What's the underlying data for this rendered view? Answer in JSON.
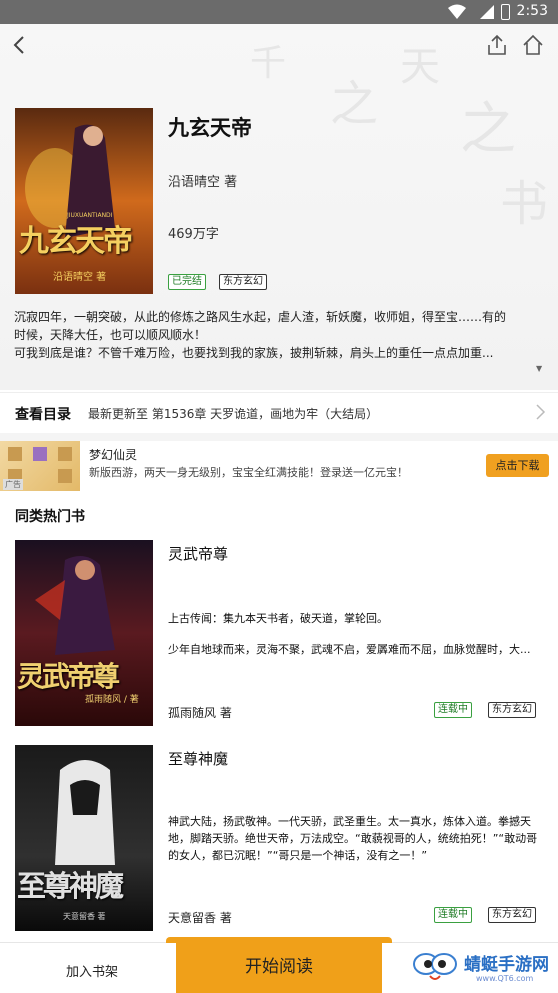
{
  "status_bar": {
    "time": "2:53"
  },
  "book": {
    "title": "九玄天帝",
    "author": "沿语晴空 著",
    "word_count": "469万字",
    "tags": [
      "已完结",
      "东方玄幻"
    ],
    "cover_text": "九玄天帝",
    "cover_author": "沿语晴空 著",
    "cover_pinyin": "JIUXUANTIANDI",
    "description_lines": [
      "沉寂四年，一朝突破，从此的修炼之路风生水起，虐人渣，斩妖魔，收师姐，得至宝……有的",
      "时候，天降大任，也可以顺风顺水！",
      "可我到底是谁？不管千难万险，也要找到我的家族，披荆斩棘，肩头上的重任一点点加重..."
    ]
  },
  "catalog": {
    "label": "查看目录",
    "latest": "最新更新至 第1536章 天罗诡道，画地为牢（大结局）"
  },
  "ad": {
    "title": "梦幻仙灵",
    "subtitle": "新版西游，两天一身无级别，宝宝全红满技能！登录送一亿元宝！",
    "button": "点击下载",
    "badge": "广告"
  },
  "similar": {
    "title": "同类热门书",
    "items": [
      {
        "title": "灵武帝尊",
        "desc1": "上古传闻：集九本天书者，破天道，掌轮回。",
        "desc2": "少年自地球而来，灵海不聚，武魂不启，爱羼难而不屈，血脉觉醒时，大...",
        "author": "孤雨随风",
        "author_suffix": "著",
        "tags": [
          "连载中",
          "东方玄幻"
        ],
        "cover_text": "灵武帝尊",
        "cover_author": "孤雨随风 / 著"
      },
      {
        "title": "至尊神魔",
        "desc": "神武大陆，扬武敬神。一代天骄，武圣重生。太一真水，炼体入道。拳撼天地，脚踏天骄。绝世天帝，万法成空。“敢藐视哥的人，统统拍死！”“敢动哥的女人，都已沉眠！”“哥只是一个神话，没有之一！”",
        "author": "天意留香",
        "author_suffix": "著",
        "tags": [
          "连载中",
          "东方玄幻"
        ],
        "cover_text": "至尊神魔",
        "cover_author": "天意留香 著"
      }
    ]
  },
  "bottom_bar": {
    "shelf": "加入书架",
    "read": "开始阅读"
  },
  "watermark": {
    "name": "蜻蜓手游网",
    "url": "www.QT6.com"
  }
}
